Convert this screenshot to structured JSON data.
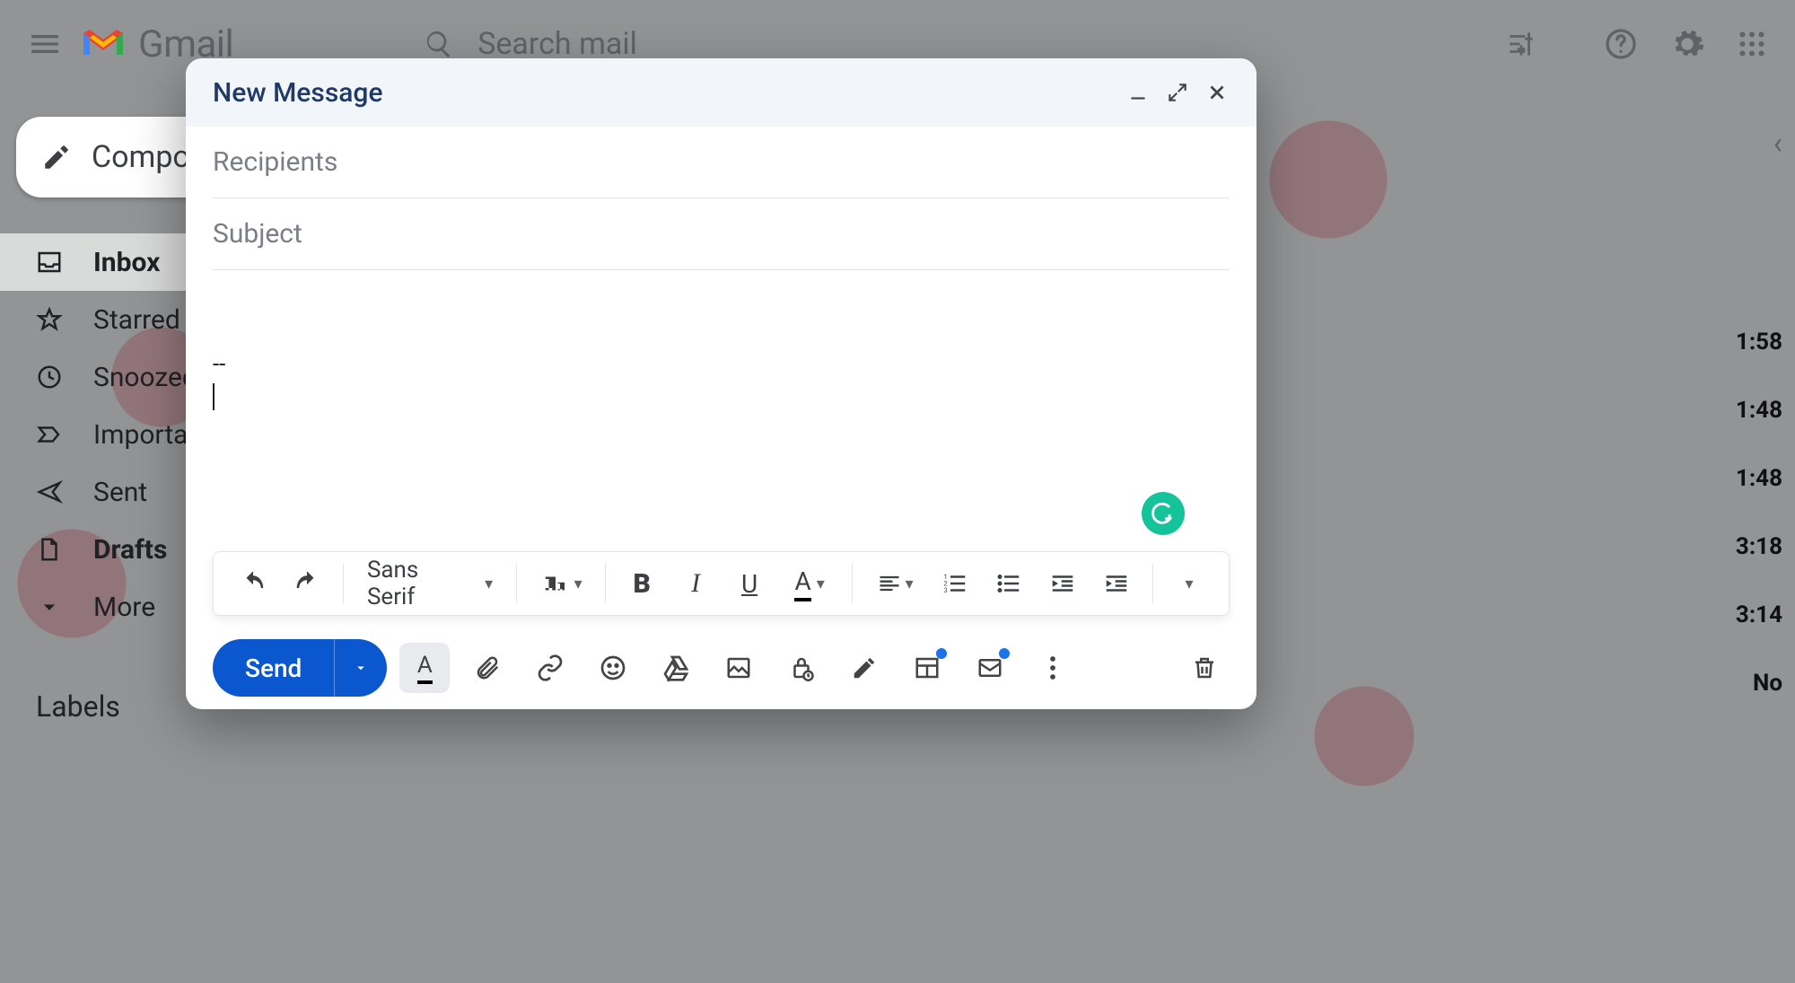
{
  "app": {
    "name": "Gmail"
  },
  "search": {
    "placeholder": "Search mail"
  },
  "sidebar": {
    "compose_label": "Compose",
    "items": [
      {
        "label": "Inbox",
        "bold": true,
        "active": true
      },
      {
        "label": "Starred",
        "bold": false,
        "active": false
      },
      {
        "label": "Snoozed",
        "bold": false,
        "active": false
      },
      {
        "label": "Important",
        "bold": false,
        "active": false
      },
      {
        "label": "Sent",
        "bold": false,
        "active": false
      },
      {
        "label": "Drafts",
        "bold": true,
        "active": false
      },
      {
        "label": "More",
        "bold": false,
        "active": false
      }
    ],
    "labels_header": "Labels"
  },
  "right_times": [
    "1:58",
    "1:48",
    "1:48",
    "3:18",
    "3:14",
    "No"
  ],
  "compose": {
    "title": "New Message",
    "recipients_placeholder": "Recipients",
    "subject_placeholder": "Subject",
    "recipients_value": "",
    "subject_value": "",
    "body": "",
    "signature_separator": "--",
    "font_family_label": "Sans Serif",
    "send_label": "Send",
    "toolbar_icons": [
      "undo",
      "redo",
      "font-family",
      "font-size",
      "bold",
      "italic",
      "underline",
      "text-color",
      "align",
      "numbered-list",
      "bulleted-list",
      "indent-decrease",
      "indent-increase",
      "more-formatting"
    ],
    "action_icons": [
      "formatting-options",
      "attach-file",
      "insert-link",
      "insert-emoji",
      "insert-drive",
      "insert-photo",
      "confidential-mode",
      "insert-signature",
      "insert-template",
      "schedule-send",
      "more-options",
      "discard-draft"
    ]
  },
  "colors": {
    "accent": "#0b57d0",
    "grammarly": "#15c39a"
  }
}
